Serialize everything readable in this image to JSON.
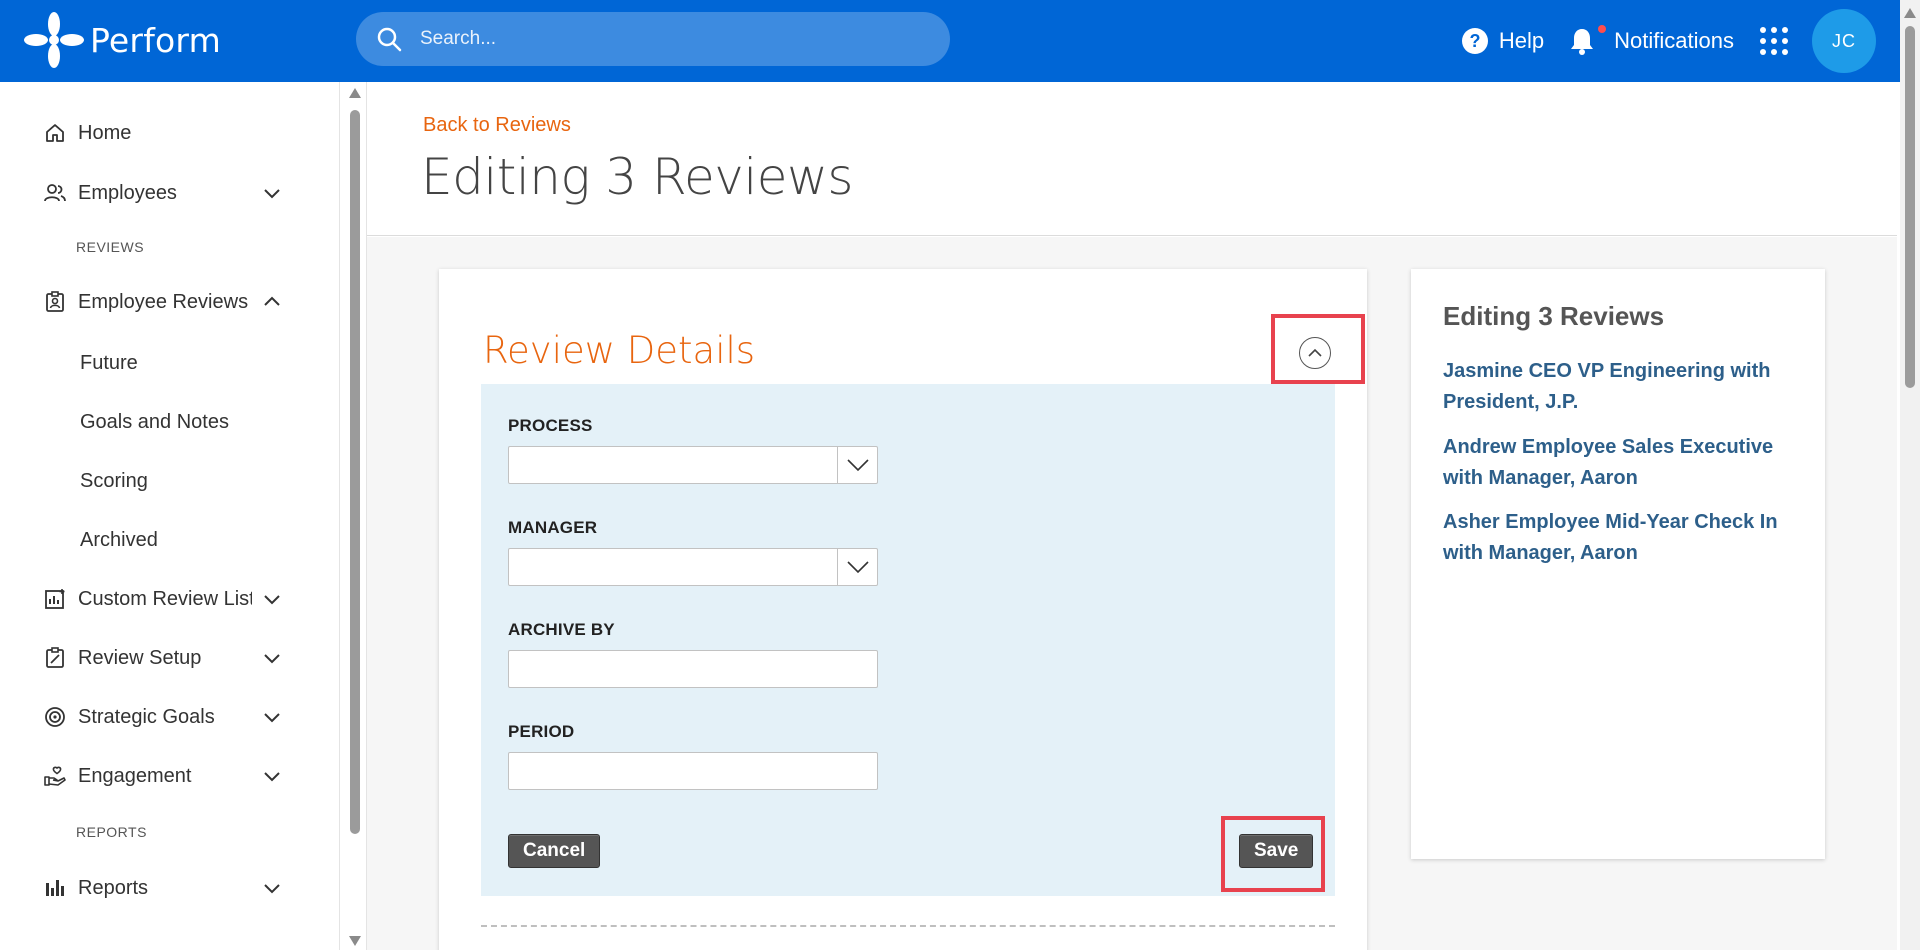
{
  "header": {
    "brand": "Perform",
    "search_placeholder": "Search...",
    "help_label": "Help",
    "notifications_label": "Notifications",
    "avatar_initials": "JC",
    "brand_color": "#0066d6"
  },
  "sidebar": {
    "items": [
      {
        "label": "Home",
        "icon": "home-icon"
      },
      {
        "label": "Employees",
        "icon": "people-icon"
      },
      {
        "label": "Employee Reviews",
        "icon": "clipboard-user-icon"
      },
      {
        "label": "Custom Review Lists",
        "icon": "chart-icon"
      },
      {
        "label": "Review Setup",
        "icon": "clipboard-edit-icon"
      },
      {
        "label": "Strategic Goals",
        "icon": "target-icon"
      },
      {
        "label": "Engagement",
        "icon": "hand-heart-icon"
      },
      {
        "label": "Reports",
        "icon": "bar-chart-icon"
      }
    ],
    "section_reviews": "REVIEWS",
    "section_reports": "REPORTS",
    "sub_items": [
      "Future",
      "Goals and Notes",
      "Scoring",
      "Archived"
    ]
  },
  "main": {
    "back_link": "Back to Reviews",
    "title": "Editing 3 Reviews",
    "card": {
      "title": "Review Details",
      "fields": {
        "process_label": "PROCESS",
        "process_value": "",
        "manager_label": "MANAGER",
        "manager_value": "",
        "archive_label": "ARCHIVE BY",
        "archive_value": "",
        "period_label": "PERIOD",
        "period_value": ""
      },
      "cancel_label": "Cancel",
      "save_label": "Save"
    },
    "side": {
      "title": "Editing 3 Reviews",
      "reviews": [
        "Jasmine CEO VP Engineering with President, J.P.",
        "Andrew Employee Sales Executive with Manager, Aaron",
        "Asher Employee Mid-Year Check In with Manager, Aaron"
      ]
    }
  },
  "colors": {
    "accent": "#e8650f",
    "highlight": "#e8424e",
    "link": "#2d5f8a",
    "panel": "#e4f1f8"
  }
}
